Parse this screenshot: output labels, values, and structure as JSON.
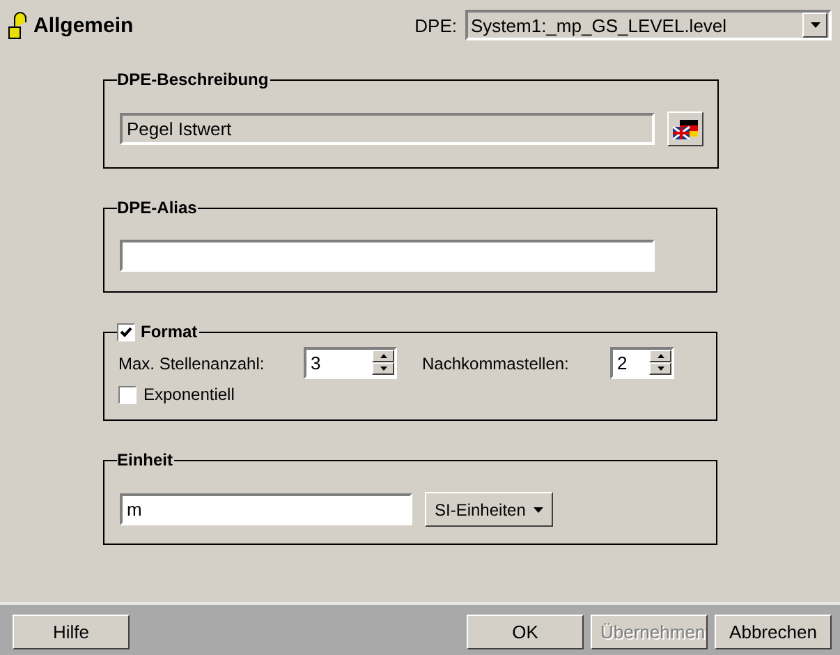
{
  "header": {
    "title": "Allgemein",
    "dpe_label": "DPE:",
    "dpe_value": "System1:_mp_GS_LEVEL.level"
  },
  "description": {
    "title": "DPE-Beschreibung",
    "value": "Pegel Istwert"
  },
  "alias": {
    "title": "DPE-Alias"
  },
  "format": {
    "title": "Format",
    "checked": true,
    "max_digits_label": "Max. Stellenanzahl:",
    "max_digits": "3",
    "decimals_label": "Nachkommastellen:",
    "decimals": "2",
    "exponential": {
      "label": "Exponentiell",
      "checked": false
    }
  },
  "unit": {
    "title": "Einheit",
    "value": "m",
    "menu_button": "SI-Einheiten"
  },
  "buttons": [
    {
      "label": "Hilfe",
      "disabled": false,
      "kind": "left"
    },
    {
      "label": "OK",
      "disabled": false,
      "kind": "right"
    },
    {
      "label": "Übernehmen",
      "disabled": true,
      "kind": "right"
    },
    {
      "label": "Abbrechen",
      "disabled": false,
      "kind": "right"
    }
  ]
}
